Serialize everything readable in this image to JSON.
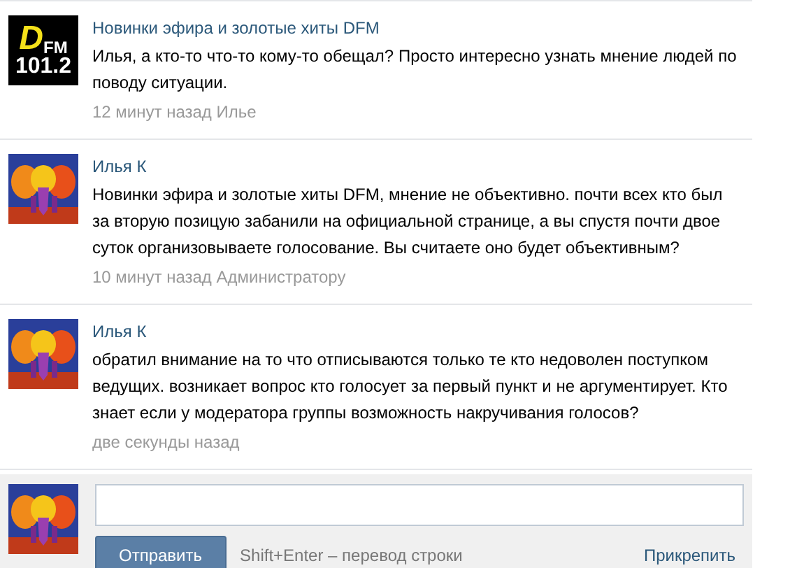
{
  "comments": [
    {
      "author": "Новинки эфира и золотые хиты DFM",
      "avatar": {
        "kind": "logo",
        "letter": "D",
        "suffix": "FM",
        "frequency": "101.2"
      },
      "text": "Илья, а кто-то что-то кому-то обещал? Просто интересно узнать мнение людей по поводу ситуации.",
      "time": "12 минут назад Илье"
    },
    {
      "author": "Илья К",
      "avatar": {
        "kind": "painting"
      },
      "text": "Новинки эфира и золотые хиты DFM, мнение не объективно. почти всех кто был за вторую позицую забанили на официальной странице, а вы спустя почти двое суток организовываете голосование. Вы считаете оно будет объективным?",
      "time": "10 минут назад Администратору"
    },
    {
      "author": "Илья К",
      "avatar": {
        "kind": "painting"
      },
      "text": "обратил внимание на то что отписываются только те кто недоволен поступком ведущих. возникает вопрос кто голосует за первый пункт и не аргументирует. Кто знает если у модератора группы возможность накручивания голосов?",
      "time": "две секунды назад"
    }
  ],
  "reply_form": {
    "avatar": {
      "kind": "painting"
    },
    "button": "Отправить",
    "hint": "Shift+Enter – перевод строки",
    "attach": "Прикрепить"
  }
}
